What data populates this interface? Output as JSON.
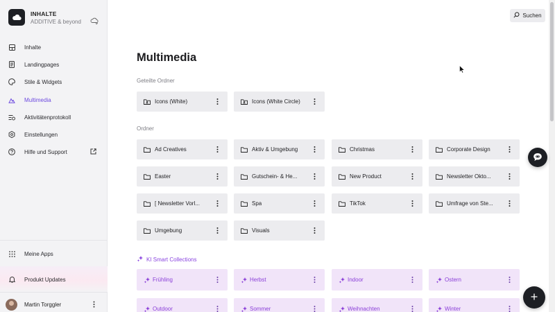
{
  "brand": {
    "title": "INHALTE",
    "subtitle": "ADDITIVE & beyond"
  },
  "nav": {
    "items": [
      {
        "label": "Inhalte",
        "icon": "grid-icon"
      },
      {
        "label": "Landingpages",
        "icon": "page-icon"
      },
      {
        "label": "Stile & Widgets",
        "icon": "palette-icon"
      },
      {
        "label": "Multimedia",
        "icon": "media-icon"
      },
      {
        "label": "Aktivitätenprotokoll",
        "icon": "activity-icon"
      },
      {
        "label": "Einstellungen",
        "icon": "settings-icon"
      },
      {
        "label": "Hilfe und Support",
        "icon": "help-icon"
      }
    ],
    "my_apps": "Meine Apps",
    "product_updates": "Produkt Updates"
  },
  "user": {
    "name": "Martin Torggler"
  },
  "search": {
    "label": "Suchen"
  },
  "page": {
    "title": "Multimedia",
    "shared_label": "Geteilte Ordner",
    "folders_label": "Ordner",
    "smart_label": "KI Smart Collections"
  },
  "shared_folders": [
    "Icons (White)",
    "Icons (White Circle)"
  ],
  "folders": [
    "Ad Creatives",
    "Aktiv & Umgebung",
    "Christmas",
    "Corporate Design",
    "Easter",
    "Gutschein- & He...",
    "New Product",
    "Newsletter Okto...",
    "[ Newsletter Vorl...",
    "Spa",
    "TikTok",
    "Umfrage von Ste...",
    "Umgebung",
    "Visuals"
  ],
  "smart_collections": [
    "Frühling",
    "Herbst",
    "Indoor",
    "Ostern",
    "Outdoor",
    "Sommer",
    "Weihnachten",
    "Winter"
  ],
  "colors": {
    "accent": "#6d4adf",
    "smart": "#8a3fd8",
    "smart_bg": "#f1e4f9",
    "dark": "#1d1f24"
  }
}
